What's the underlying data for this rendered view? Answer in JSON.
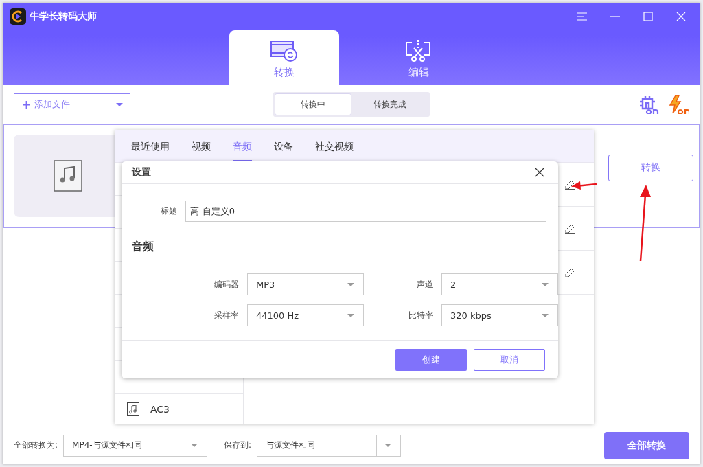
{
  "window": {
    "title": "牛学长转码大师"
  },
  "main_tabs": [
    {
      "label": "转换",
      "kind": "convert",
      "selected": true
    },
    {
      "label": "编辑",
      "kind": "edit",
      "selected": false
    }
  ],
  "toolbar": {
    "add_file": "添加文件",
    "status_tabs": [
      {
        "label": "转换中",
        "selected": true
      },
      {
        "label": "转换完成",
        "selected": false
      }
    ]
  },
  "file_card": {
    "convert_button": "转换"
  },
  "format_popup": {
    "tabs": [
      {
        "label": "最近使用",
        "selected": false
      },
      {
        "label": "视频",
        "selected": false
      },
      {
        "label": "音频",
        "selected": true
      },
      {
        "label": "设备",
        "selected": false
      },
      {
        "label": "社交视频",
        "selected": false
      }
    ],
    "formats": [
      {
        "label": "AC3"
      }
    ]
  },
  "dialog": {
    "title": "设置",
    "title_label": "标题",
    "title_value": "高-自定义0",
    "section": "音频",
    "fields": [
      {
        "label": "编码器",
        "value": "MP3"
      },
      {
        "label": "声道",
        "value": "2"
      },
      {
        "label": "采样率",
        "value": "44100 Hz"
      },
      {
        "label": "比特率",
        "value": "320 kbps"
      }
    ],
    "buttons": [
      {
        "label": "创建",
        "kind": "primary"
      },
      {
        "label": "取消",
        "kind": "secondary"
      }
    ]
  },
  "bottom_bar": {
    "convert_all_label": "全部转换为:",
    "convert_all_value": "MP4-与源文件相同",
    "save_label": "保存到:",
    "save_value": "与源文件相同",
    "convert_all_button": "全部转换"
  }
}
